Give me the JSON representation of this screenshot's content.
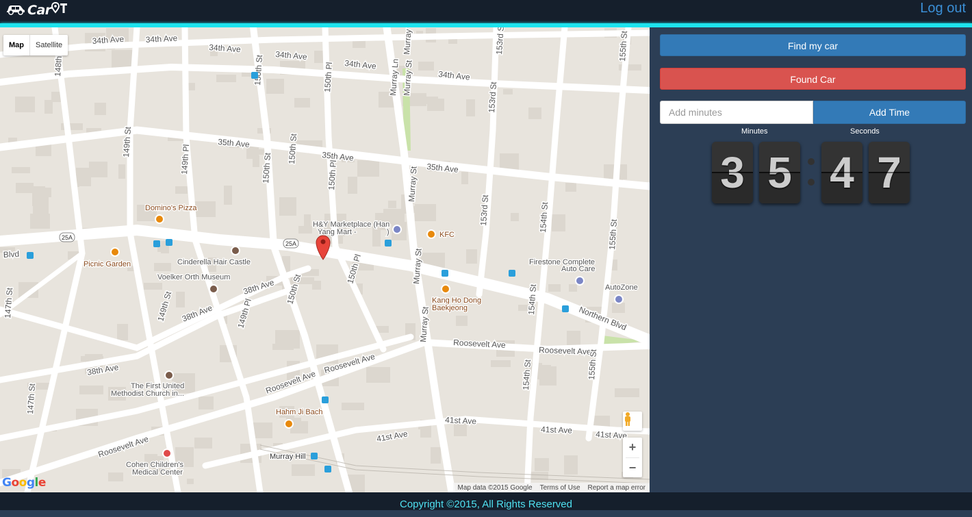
{
  "header": {
    "app_name": "Car",
    "logout_label": "Log out"
  },
  "map": {
    "type_map": "Map",
    "type_satellite": "Satellite",
    "zoom_in": "+",
    "zoom_out": "−",
    "google_logo": "Google",
    "footer": {
      "map_data": "Map data ©2015 Google",
      "terms": "Terms of Use",
      "report": "Report a map error"
    },
    "street_labels": [
      "34th Ave",
      "34th Ave",
      "34th Ave",
      "34th Ave",
      "34th Ave",
      "34th Ave",
      "35th Ave",
      "35th Ave",
      "35th Ave",
      "38th Ave",
      "38th Ave",
      "38th Ave",
      "Roosevelt Ave",
      "Roosevelt Ave",
      "Roosevelt Ave",
      "Roosevelt Ave",
      "Roosevelt Ave",
      "41st Ave",
      "41st Ave",
      "41st Ave",
      "41st Ave",
      "Northern Blvd",
      "Blvd",
      "148th St",
      "149th St",
      "149th Pl",
      "150th St",
      "150th Pl",
      "150th St",
      "150th Pl",
      "Murray Ln",
      "Murray St",
      "Murray St",
      "Murray St",
      "Murray St",
      "Murray St",
      "153rd St",
      "153rd St",
      "153rd St",
      "154th St",
      "154th St",
      "154th St",
      "155th St",
      "155th St",
      "155th St",
      "147th St",
      "147th St",
      "149th St",
      "149th Pl",
      "150th St",
      "150th Pl",
      "150th St",
      "25A",
      "25A"
    ],
    "places": [
      "Domino's Pizza",
      "H&Y Marketplace (Han",
      "Yang Mart -",
      ")",
      "KFC",
      "Picnic Garden",
      "Cinderella Hair Castle",
      "Voelker Orth Museum",
      "Firestone Complete",
      "Auto Care",
      "AutoZone",
      "Kang Ho Dong",
      "Baekjeong",
      "The First United",
      "Methodist Church in...",
      "Hahm Ji Bach",
      "Murray Hill",
      "Cohen Children's",
      "Medical Center"
    ]
  },
  "panel": {
    "find_label": "Find my car",
    "found_label": "Found Car",
    "minutes_placeholder": "Add minutes",
    "add_time_label": "Add Time",
    "minutes_caption": "Minutes",
    "seconds_caption": "Seconds",
    "digits": [
      "3",
      "5",
      "4",
      "7"
    ]
  },
  "footer": {
    "copyright": "Copyright ©2015, All Rights Reserved"
  },
  "colors": {
    "header_bg": "#151f2c",
    "accent_line": "#1de3ee",
    "panel_bg": "#2c3e55",
    "primary": "#337ab7",
    "danger": "#d9534f",
    "logout": "#3b8fd6",
    "footer_text": "#4fe0f0",
    "map_bg": "#e8e4dd"
  }
}
